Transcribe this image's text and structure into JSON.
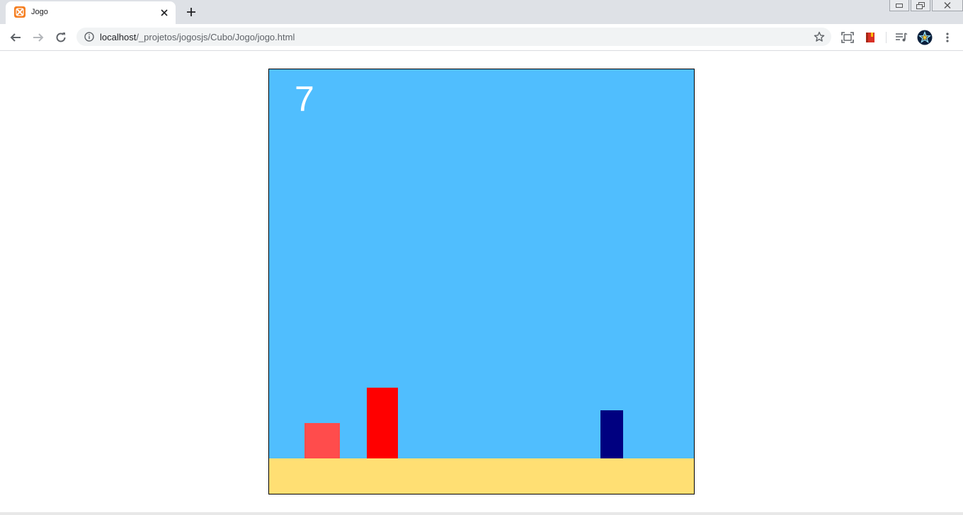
{
  "browser": {
    "tab_title": "Jogo",
    "url_host": "localhost",
    "url_path": "/_projetos/jogosjs/Cubo/Jogo/jogo.html"
  },
  "game": {
    "score": "7",
    "colors": {
      "sky": "#50befe",
      "ground": "#ffdf73",
      "player": "#ff4c4c",
      "obstacle_red": "#ff0000",
      "obstacle_navy": "#000080",
      "score_text": "#ffffff"
    }
  }
}
